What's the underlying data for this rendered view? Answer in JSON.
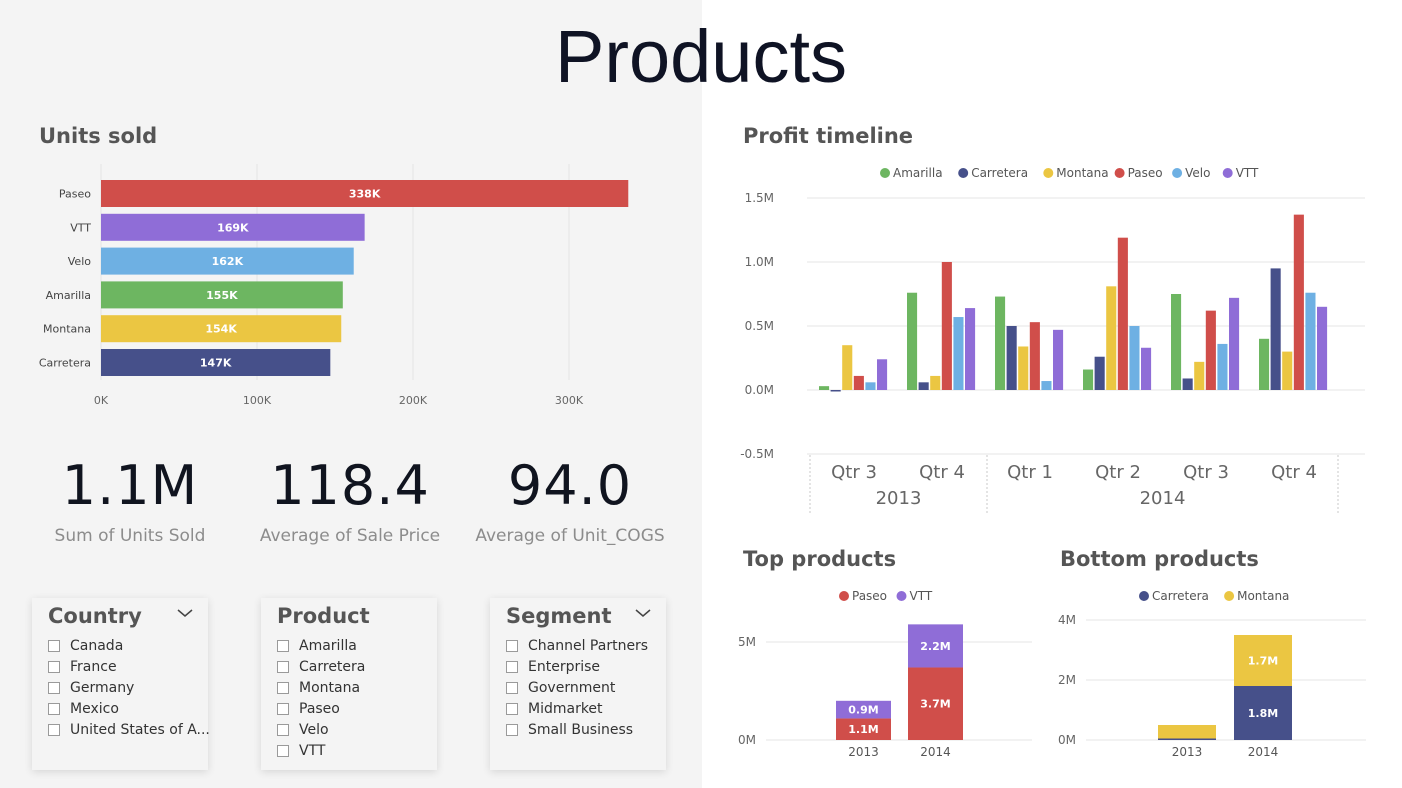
{
  "page": {
    "title": "Products"
  },
  "units_sold": {
    "heading": "Units sold",
    "labels": [
      "338K",
      "169K",
      "162K",
      "155K",
      "154K",
      "147K"
    ]
  },
  "profit_timeline": {
    "heading": "Profit timeline",
    "year_labels": [
      "2013",
      "2014"
    ]
  },
  "top_products": {
    "heading": "Top products",
    "labels": [
      "1.1M",
      "0.9M",
      "3.7M",
      "2.2M"
    ]
  },
  "bottom_products": {
    "heading": "Bottom products",
    "labels": [
      "1.8M",
      "1.7M"
    ]
  },
  "cards": [
    {
      "value": "1.1M",
      "label": "Sum of Units Sold"
    },
    {
      "value": "118.4",
      "label": "Average of Sale Price"
    },
    {
      "value": "94.0",
      "label": "Average of Unit_COGS"
    }
  ],
  "slicers": {
    "country": {
      "title": "Country",
      "items": [
        "Canada",
        "France",
        "Germany",
        "Mexico",
        "United States of A..."
      ]
    },
    "product": {
      "title": "Product",
      "items": [
        "Amarilla",
        "Carretera",
        "Montana",
        "Paseo",
        "Velo",
        "VTT"
      ]
    },
    "segment": {
      "title": "Segment",
      "items": [
        "Channel Partners",
        "Enterprise",
        "Government",
        "Midmarket",
        "Small Business"
      ]
    }
  },
  "colors": {
    "Amarilla": "#6db661",
    "Carretera": "#46508a",
    "Montana": "#ebc642",
    "Paseo": "#d04e4a",
    "Velo": "#6eb0e3",
    "VTT": "#8f6dd7"
  },
  "chart_data": [
    {
      "type": "bar",
      "orientation": "horizontal",
      "title": "Units sold",
      "categories": [
        "Paseo",
        "VTT",
        "Velo",
        "Amarilla",
        "Montana",
        "Carretera"
      ],
      "values": [
        338000,
        169000,
        162000,
        155000,
        154000,
        147000
      ],
      "xlim": [
        0,
        340000
      ],
      "xticks": [
        "0K",
        "100K",
        "200K",
        "300K"
      ],
      "grid": true
    },
    {
      "type": "bar",
      "title": "Profit timeline",
      "categories": [
        "Qtr 3",
        "Qtr 4",
        "Qtr 1",
        "Qtr 2",
        "Qtr 3",
        "Qtr 4"
      ],
      "groups": [
        "2013",
        "2013",
        "2014",
        "2014",
        "2014",
        "2014"
      ],
      "series": [
        {
          "name": "Amarilla",
          "values": [
            0.03,
            0.76,
            0.73,
            0.16,
            0.75,
            0.4
          ]
        },
        {
          "name": "Carretera",
          "values": [
            -0.01,
            0.06,
            0.5,
            0.26,
            0.09,
            0.95
          ]
        },
        {
          "name": "Montana",
          "values": [
            0.35,
            0.11,
            0.34,
            0.81,
            0.22,
            0.3
          ]
        },
        {
          "name": "Paseo",
          "values": [
            0.11,
            1.0,
            0.53,
            1.19,
            0.62,
            1.37
          ]
        },
        {
          "name": "Velo",
          "values": [
            0.06,
            0.57,
            0.07,
            0.5,
            0.36,
            0.76
          ]
        },
        {
          "name": "VTT",
          "values": [
            0.24,
            0.64,
            0.47,
            0.33,
            0.72,
            0.65
          ]
        }
      ],
      "unit": "M",
      "ylim": [
        -0.5,
        1.5
      ],
      "yticks": [
        "1.5M",
        "1.0M",
        "0.5M",
        "0.0M",
        "-0.5M"
      ],
      "legend": "top"
    },
    {
      "type": "bar",
      "stacked": true,
      "title": "Top products",
      "categories": [
        "2013",
        "2014"
      ],
      "series": [
        {
          "name": "Paseo",
          "values": [
            1.1,
            3.7
          ]
        },
        {
          "name": "VTT",
          "values": [
            0.9,
            2.2
          ]
        }
      ],
      "unit": "M",
      "ylim": [
        0,
        6
      ],
      "yticks": [
        "5M",
        "0M"
      ],
      "legend": "top"
    },
    {
      "type": "bar",
      "stacked": true,
      "title": "Bottom products",
      "categories": [
        "2013",
        "2014"
      ],
      "series": [
        {
          "name": "Carretera",
          "values": [
            0.05,
            1.8
          ]
        },
        {
          "name": "Montana",
          "values": [
            0.45,
            1.7
          ]
        }
      ],
      "unit": "M",
      "ylim": [
        0,
        4
      ],
      "yticks": [
        "4M",
        "2M",
        "0M"
      ],
      "legend": "top"
    }
  ]
}
